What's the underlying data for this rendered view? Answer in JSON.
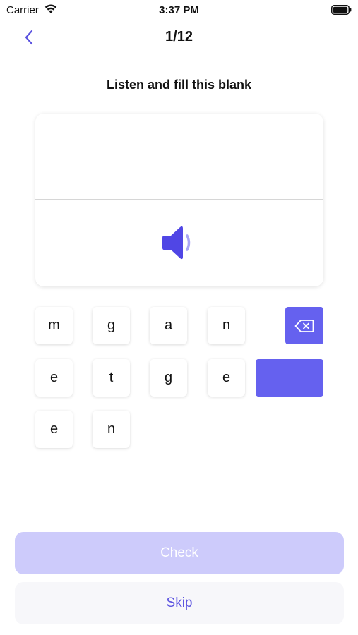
{
  "status_bar": {
    "carrier": "Carrier",
    "time": "3:37 PM"
  },
  "nav": {
    "progress": "1/12"
  },
  "instruction": "Listen and fill this blank",
  "keys": [
    "m",
    "g",
    "a",
    "n",
    "e",
    "t",
    "g",
    "e",
    "e",
    "n"
  ],
  "actions": {
    "check_label": "Check",
    "skip_label": "Skip"
  },
  "colors": {
    "accent": "#6561ef",
    "check_bg": "#cdcbfb",
    "skip_text": "#5a52e0"
  },
  "icons": {
    "back": "chevron-left-icon",
    "speaker": "speaker-icon",
    "delete": "backspace-icon"
  }
}
